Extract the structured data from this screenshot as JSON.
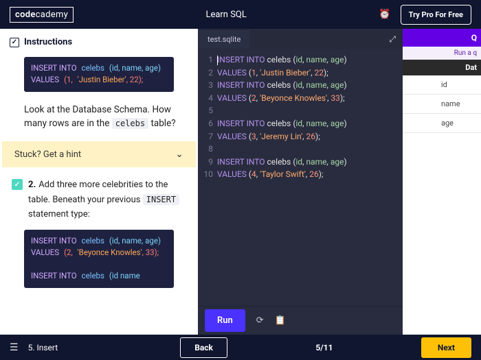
{
  "header": {
    "logo_a": "code",
    "logo_b": "cademy",
    "title": "Learn SQL",
    "try_pro": "Try Pro For Free"
  },
  "instructions": {
    "heading": "Instructions",
    "code1": {
      "l1a": "INSERT INTO",
      "l1b": "celebs",
      "l1c": "(id, name, age)",
      "l2a": "VALUES",
      "l2b": "(1,",
      "l2c": "'Justin Bieber'",
      "l2d": ", 22);"
    },
    "para1_a": "Look at the Database Schema. How many rows are in the ",
    "para1_code": "celebs",
    "para1_b": " table?",
    "hint": "Stuck? Get a hint",
    "step2_num": "2.",
    "step2_body_a": "Add three more celebrities to the table. Beneath your previous ",
    "step2_code": "INSERT",
    "step2_body_b": " statement type:",
    "code2": {
      "l1a": "INSERT INTO",
      "l1b": "celebs",
      "l1c": "(id, name, age)",
      "l2a": "VALUES",
      "l2b": "(2,",
      "l2c": "'Beyonce Knowles'",
      "l2d": ", 33);",
      "l3a": "INSERT INTO",
      "l3b": "celebs",
      "l3c": "(id  name"
    }
  },
  "tab": "test.sqlite",
  "editor_lines": [
    "1",
    "2",
    "3",
    "4",
    "5",
    "6",
    "7",
    "8",
    "9",
    "10"
  ],
  "code": {
    "r1": {
      "a": "INSERT INTO",
      "b": "celebs",
      "c": "(",
      "d": "id",
      "e": ", ",
      "f": "name",
      "g": ", ",
      "h": "age",
      "i": ")"
    },
    "r2": {
      "a": "VALUES",
      "b": " (",
      "c": "1",
      "d": ", ",
      "e": "'Justin Bieber'",
      "f": ", ",
      "g": "22",
      "h": ");"
    },
    "r3": {
      "a": "INSERT INTO",
      "b": "celebs",
      "c": "(",
      "d": "id",
      "e": ", ",
      "f": "name",
      "g": ", ",
      "h": "age",
      "i": ")"
    },
    "r4": {
      "a": "VALUES",
      "b": " (",
      "c": "2",
      "d": ", ",
      "e": "'Beyonce Knowles'",
      "f": ", ",
      "g": "33",
      "h": ");"
    },
    "r6": {
      "a": "INSERT INTO",
      "b": "celebs",
      "c": "(",
      "d": "id",
      "e": ", ",
      "f": "name",
      "g": ", ",
      "h": "age",
      "i": ")"
    },
    "r7": {
      "a": "VALUES",
      "b": " (",
      "c": "3",
      "d": ", ",
      "e": "'Jeremy Lin'",
      "f": ", ",
      "g": "26",
      "h": ");"
    },
    "r9": {
      "a": "INSERT INTO",
      "b": "celebs",
      "c": "(",
      "d": "id",
      "e": ", ",
      "f": "name",
      "g": ", ",
      "h": "age",
      "i": ")"
    },
    "r10": {
      "a": "VALUES",
      "b": " (",
      "c": "4",
      "d": ", ",
      "e": "'Taylor Swift'",
      "f": ", ",
      "g": "26",
      "h": ");"
    }
  },
  "run_bar": {
    "run": "Run"
  },
  "right_panel": {
    "q": "Q",
    "run_q": "Run a q",
    "data": "Dat",
    "cols": [
      "id",
      "name",
      "age"
    ]
  },
  "footer": {
    "step": "5. Insert",
    "back": "Back",
    "progress": "5/11",
    "next": "Next"
  }
}
